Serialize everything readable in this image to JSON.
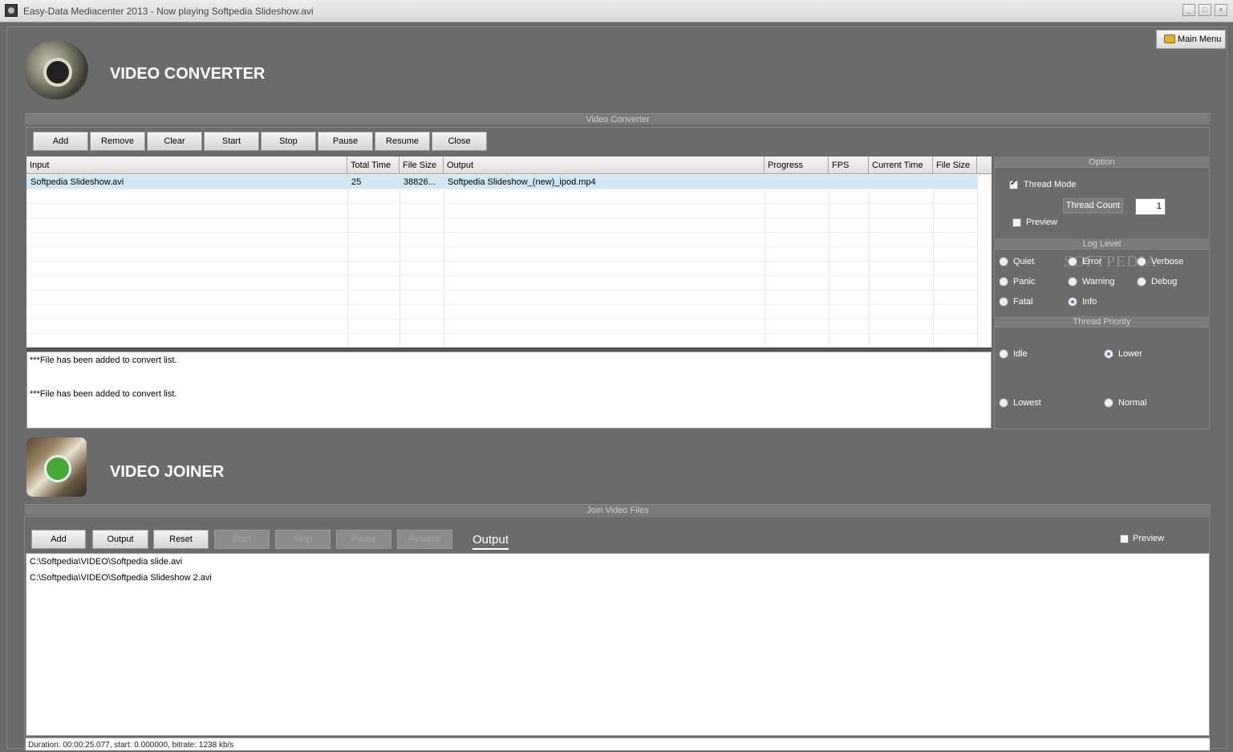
{
  "window": {
    "title": "Easy-Data Mediacenter 2013 - Now playing Softpedia Slideshow.avi",
    "buttons": [
      "_",
      "□",
      "×"
    ]
  },
  "main_menu": {
    "label": "Main Menu"
  },
  "converter": {
    "heading": "VIDEO CONVERTER",
    "panel_title": "Video Converter",
    "toolbar": [
      "Add",
      "Remove",
      "Clear",
      "Start",
      "Stop",
      "Pause",
      "Resume",
      "Close"
    ],
    "columns": [
      "Input",
      "Total Time",
      "File Size",
      "Output",
      "Progress",
      "FPS",
      "Current Time",
      "File Size"
    ],
    "rows": [
      [
        "Softpedia Slideshow.avi",
        "25",
        "38826...",
        "Softpedia Slideshow_(new)_ipod.mp4",
        "",
        "",
        "",
        ""
      ]
    ],
    "log": [
      "***File has been added to convert list.",
      "***File has been added to convert list."
    ]
  },
  "options": {
    "title": "Option",
    "thread_mode": {
      "label": "Thread Mode",
      "checked": true
    },
    "thread_count": {
      "label": "Thread Count",
      "value": "1"
    },
    "preview": {
      "label": "Preview",
      "checked": false
    },
    "log_level": {
      "title": "Log Level",
      "items": [
        "Quiet",
        "Error",
        "Verbose",
        "Panic",
        "Warning",
        "Debug",
        "Fatal",
        "Info"
      ],
      "selected": "Info"
    },
    "thread_priority": {
      "title": "Thread Priority",
      "items": [
        "Idle",
        "Lower",
        "Lowest",
        "Normal"
      ],
      "selected": "Lower"
    }
  },
  "joiner": {
    "heading": "VIDEO JOINER",
    "panel_title": "Join Video Files",
    "toolbar": [
      "Add",
      "Output",
      "Reset",
      "Start",
      "Stop",
      "Pause",
      "Resume"
    ],
    "output_tab": "Output",
    "preview": {
      "label": "Preview",
      "checked": false
    },
    "files": [
      "C:\\Softpedia\\VIDEO\\Softpedia slide.avi",
      "C:\\Softpedia\\VIDEO\\Softpedia Slideshow 2.avi"
    ],
    "status": "Duration: 00:00:25.077, start: 0.000000, bitrate: 1238 kb/s"
  },
  "watermark": "SOFTPEDIA"
}
